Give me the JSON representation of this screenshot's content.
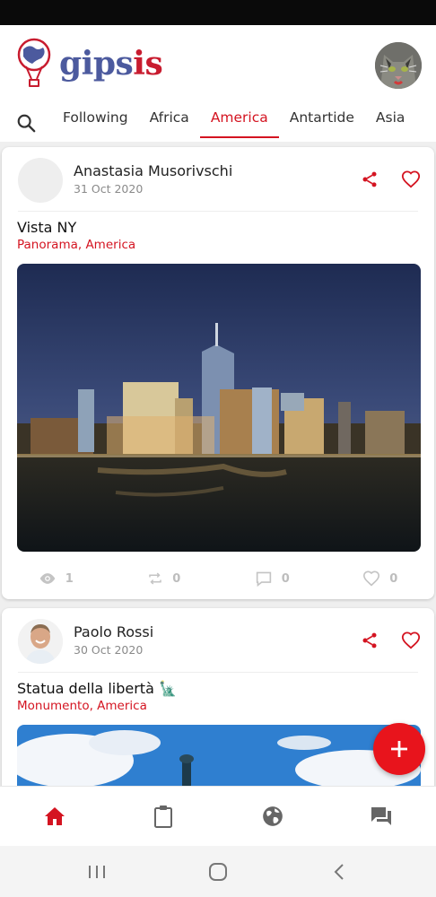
{
  "app": {
    "logo_text_main": "gips",
    "logo_text_accent": "is",
    "brand_color": "#4c5a9e",
    "accent_color": "#d41421"
  },
  "tabs": {
    "search_icon": "search-icon",
    "items": [
      {
        "label": "Following",
        "active": false
      },
      {
        "label": "Africa",
        "active": false
      },
      {
        "label": "America",
        "active": true
      },
      {
        "label": "Antartide",
        "active": false
      },
      {
        "label": "Asia",
        "active": false
      }
    ]
  },
  "posts": [
    {
      "author": "Anastasia Musorivschi",
      "date": "31 Oct 2020",
      "title": "Vista NY",
      "tags": "Panorama, America",
      "stats": {
        "views": "1",
        "reposts": "0",
        "comments": "0",
        "likes": "0"
      }
    },
    {
      "author": "Paolo Rossi",
      "date": "30 Oct 2020",
      "title": "Statua della libertà 🗽",
      "tags": "Monumento, America"
    }
  ],
  "fab": {
    "icon": "plus-icon"
  },
  "bottom_nav": [
    "home-icon",
    "clipboard-icon",
    "globe-icon",
    "chat-icon"
  ],
  "system_nav": [
    "recent-apps-icon",
    "home-circle-icon",
    "back-icon"
  ]
}
